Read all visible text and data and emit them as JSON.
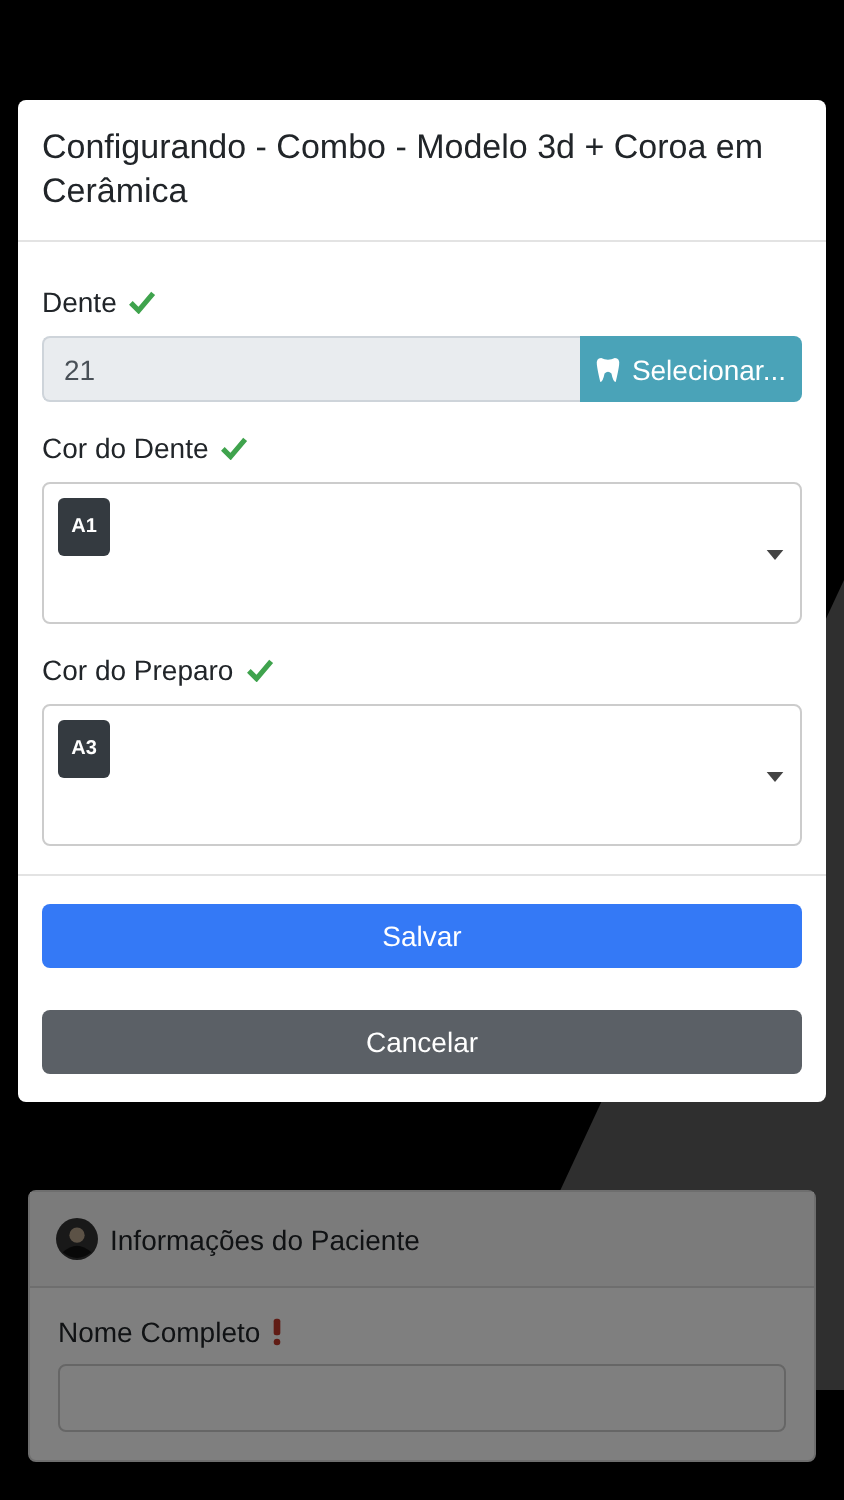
{
  "background": {
    "card": {
      "title": "Informações do Paciente",
      "fields": [
        {
          "label": "Nome Completo",
          "valid": false
        }
      ]
    }
  },
  "modal": {
    "title": "Configurando - Combo - Modelo 3d + Coroa em Cerâmica",
    "fields": [
      {
        "kind": "input",
        "label": "Dente",
        "valid": true,
        "value": "21",
        "button": "Selecionar..."
      },
      {
        "kind": "select",
        "label": "Cor do Dente",
        "valid": true,
        "tags": [
          "A1"
        ]
      },
      {
        "kind": "select",
        "label": "Cor do Preparo",
        "valid": true,
        "tags": [
          "A3"
        ]
      }
    ],
    "buttons": [
      {
        "label": "Salvar",
        "kind": "primary"
      },
      {
        "label": "Cancelar",
        "kind": "secondary"
      }
    ]
  }
}
